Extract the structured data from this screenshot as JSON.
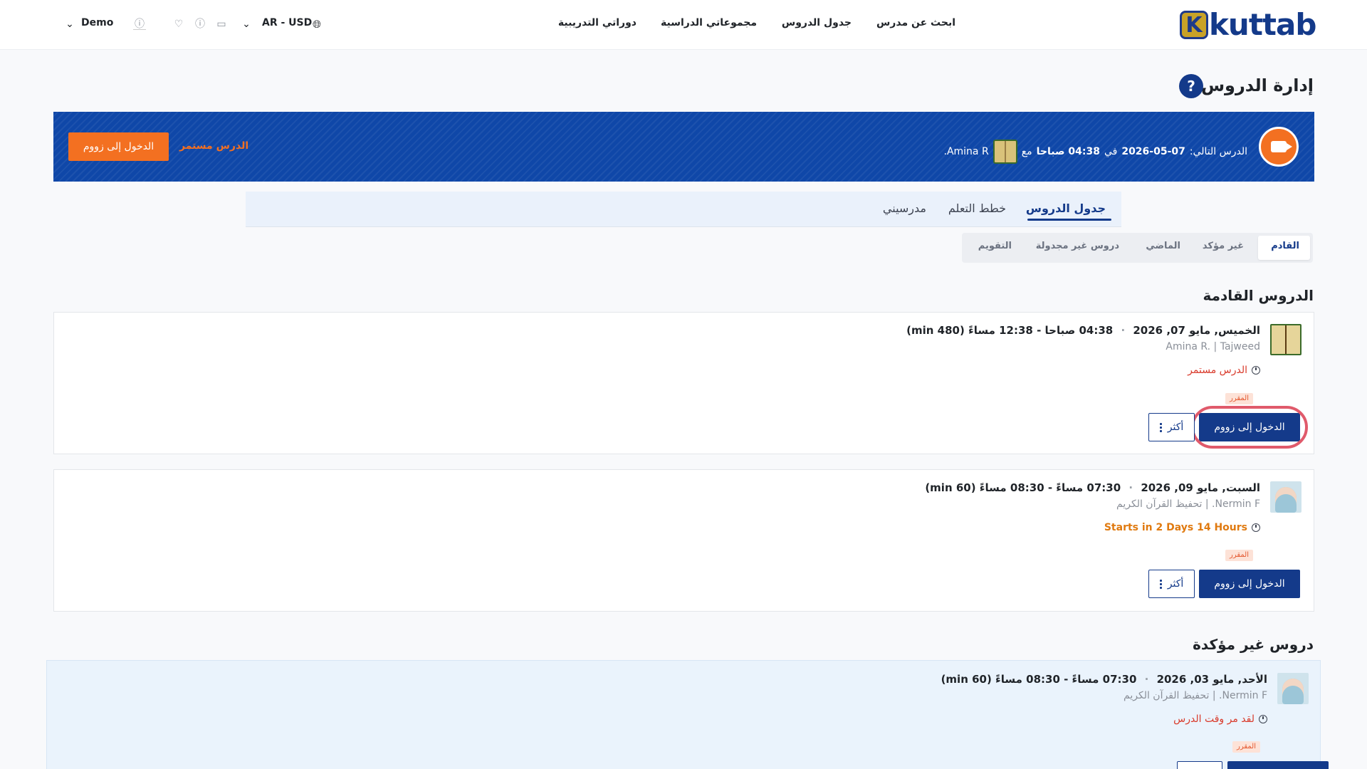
{
  "header": {
    "logo_letter": "K",
    "logo_text": "kuttab",
    "nav": [
      "ابحث عن مدرس",
      "جدول الدروس",
      "مجموعاتي الدراسية",
      "دوراتي التدريبية"
    ],
    "currency": "AR - USD",
    "user": "Demo",
    "icons": [
      "globe-icon",
      "chevron-down-icon",
      "chat-icon",
      "help-icon",
      "heart-icon",
      "info-icon"
    ]
  },
  "page": {
    "title": "إدارة الدروس",
    "help": "?"
  },
  "banner": {
    "prefix": "الدرس التالي:",
    "date": "2026-05-07",
    "at": "في",
    "time": "04:38 صباحا",
    "with": "مع",
    "teacher": "Amina R.",
    "live_text": "الدرس مستمر",
    "button": "الدخول إلى زووم"
  },
  "tabs": {
    "items": [
      "جدول الدروس",
      "خطط التعلم",
      "مدرسيني"
    ],
    "active": "جدول الدروس"
  },
  "subtabs": {
    "items": [
      "القادم",
      "غير مؤكد",
      "الماضي",
      "دروس غير مجدولة",
      "التقويم"
    ],
    "active": "القادم"
  },
  "sections": {
    "upcoming": "الدروس القادمة",
    "unconfirmed": "دروس غير مؤكدة"
  },
  "lessons": [
    {
      "date": "الخميس, مايو 07, 2026",
      "time": "04:38 صباحا - 12:38 مساءً (480 min)",
      "sub": "Amina R. | Tajweed",
      "status": "الدرس مستمر",
      "status_color": "#d93a2b",
      "badge": "المقرر",
      "zoom": "الدخول إلى زووم",
      "more": "أكثر"
    },
    {
      "date": "السبت, مايو 09, 2026",
      "time": "07:30 مساءً - 08:30 مساءً (60 min)",
      "sub": "Nermin F. | تحفيظ القرآن الكريم",
      "status": "Starts in 2 Days 14 Hours",
      "status_color": "#e07a10",
      "badge": "المقرر",
      "zoom": "الدخول إلى زووم",
      "more": "أكثر"
    },
    {
      "date": "الأحد, مايو 03, 2026",
      "time": "07:30 مساءً - 08:30 مساءً (60 min)",
      "sub": "Nermin F. | تحفيظ القرآن الكريم",
      "status": "لقد مر وقت الدرس",
      "status_color": "#d93a2b",
      "badge": "المقرر"
    }
  ],
  "colors": {
    "primary": "#143a8a",
    "banner": "#0f47a8",
    "accent": "#f37021",
    "highlight_ring": "#e05a6b"
  }
}
